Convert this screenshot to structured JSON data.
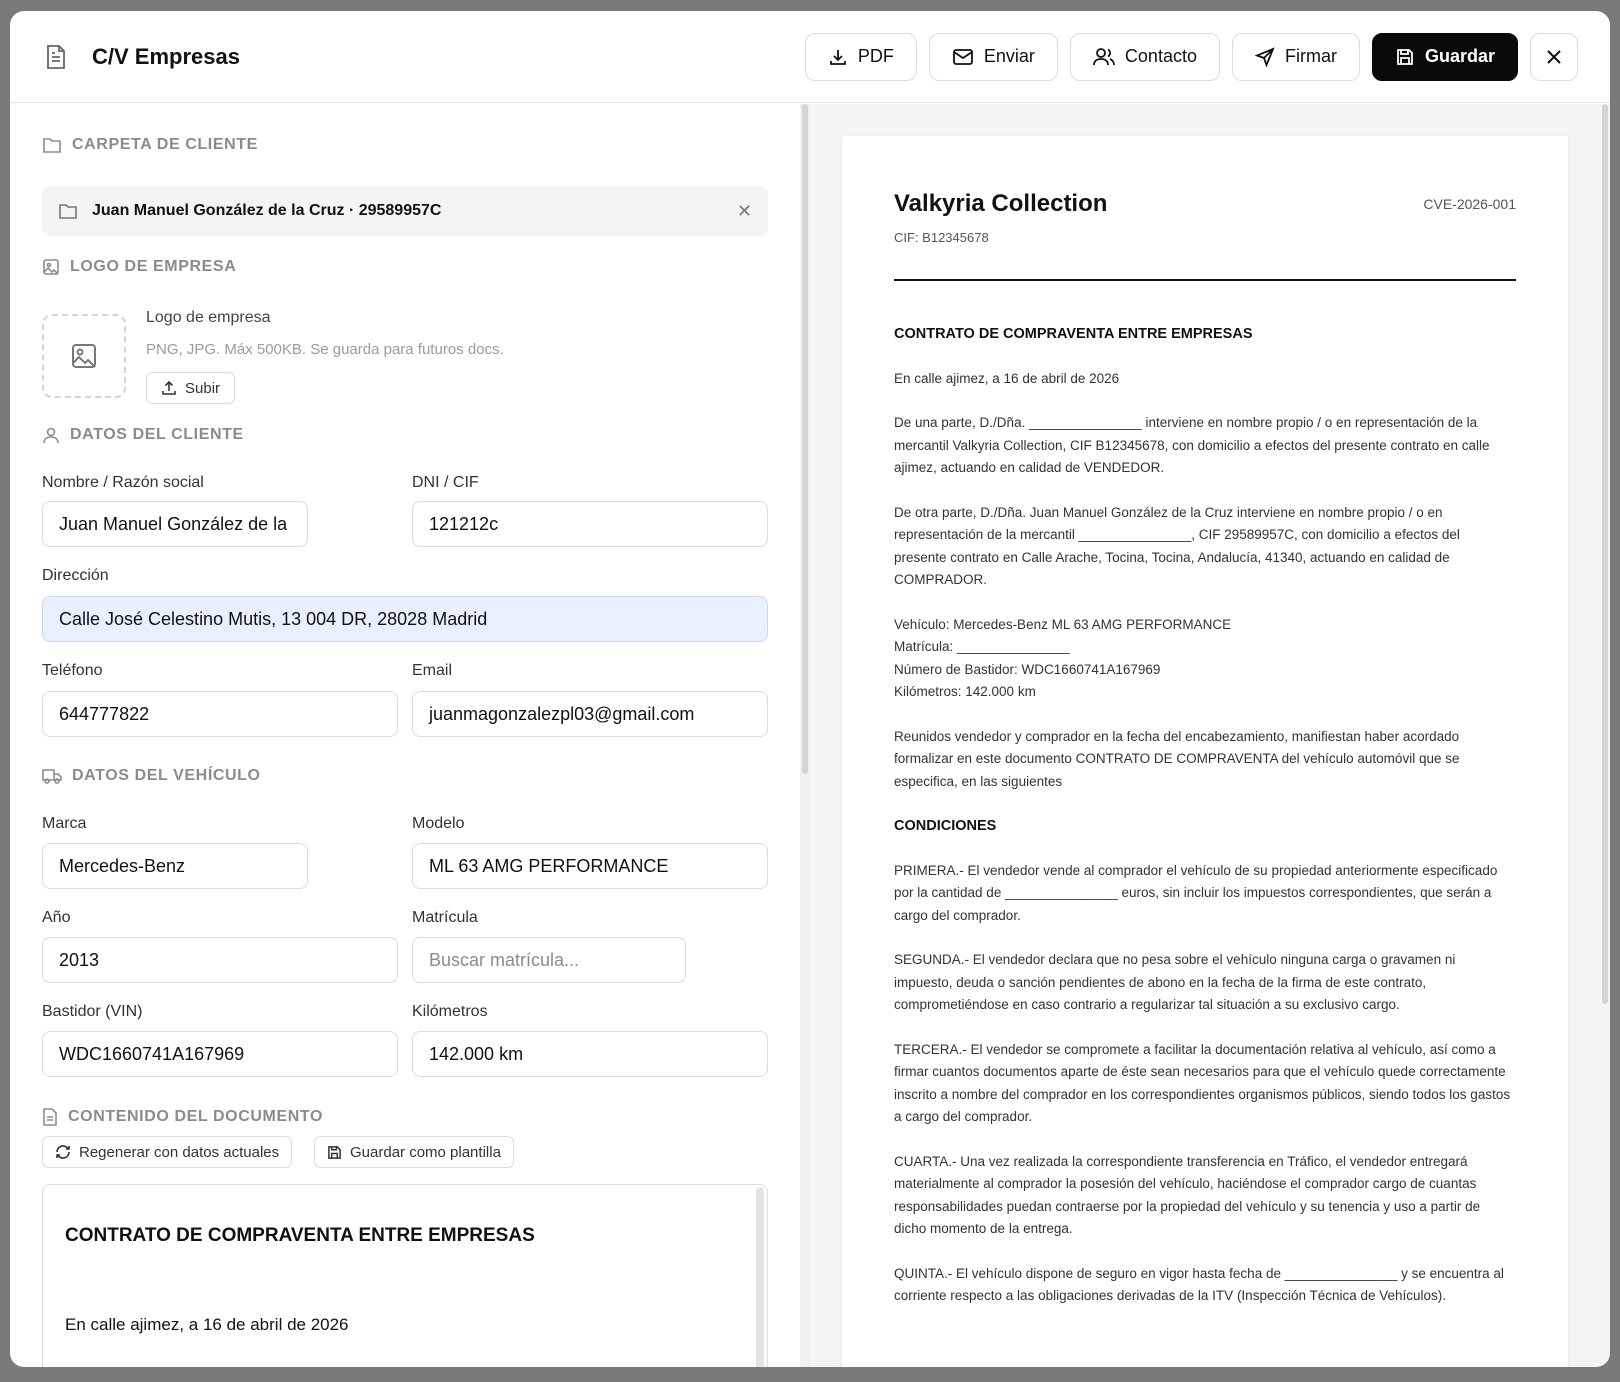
{
  "header": {
    "title": "C/V Empresas",
    "buttons": {
      "pdf": "PDF",
      "send": "Enviar",
      "contact": "Contacto",
      "sign": "Firmar",
      "save": "Guardar"
    }
  },
  "client_folder": {
    "section": "CARPETA DE CLIENTE",
    "value": "Juan Manuel González de la Cruz · 29589957C"
  },
  "logo": {
    "section": "LOGO DE EMPRESA",
    "title": "Logo de empresa",
    "hint": "PNG, JPG. Máx 500KB. Se guarda para futuros docs.",
    "upload": "Subir"
  },
  "client": {
    "section": "DATOS DEL CLIENTE",
    "name_label": "Nombre / Razón social",
    "name": "Juan Manuel González de la",
    "dni_label": "DNI / CIF",
    "dni": "121212c",
    "address_label": "Dirección",
    "address": "Calle José Celestino Mutis, 13 004 DR, 28028 Madrid",
    "phone_label": "Teléfono",
    "phone": "644777822",
    "email_label": "Email",
    "email": "juanmagonzalezpl03@gmail.com"
  },
  "vehicle": {
    "section": "DATOS DEL VEHÍCULO",
    "brand_label": "Marca",
    "brand": "Mercedes-Benz",
    "model_label": "Modelo",
    "model": "ML 63 AMG PERFORMANCE",
    "year_label": "Año",
    "year": "2013",
    "plate_label": "Matrícula",
    "plate_placeholder": "Buscar matrícula...",
    "vin_label": "Bastidor (VIN)",
    "vin": "WDC1660741A167969",
    "km_label": "Kilómetros",
    "km": "142.000 km"
  },
  "content": {
    "section": "CONTENIDO DEL DOCUMENTO",
    "regen": "Regenerar con datos actuales",
    "save_template": "Guardar como plantilla",
    "editor_title": "CONTRATO DE COMPRAVENTA ENTRE EMPRESAS",
    "editor_line": "En calle ajimez, a 16 de abril de 2026"
  },
  "preview": {
    "company": "Valkyria Collection",
    "ref": "CVE-2026-001",
    "cif": "CIF: B12345678",
    "heading": "CONTRATO DE COMPRAVENTA ENTRE EMPRESAS",
    "date_line": "En calle ajimez, a 16 de abril de 2026",
    "p1": "De una parte, D./Dña. _______________ interviene en nombre propio / o en representación de la mercantil Valkyria Collection, CIF B12345678, con domicilio a efectos del presente contrato en calle ajimez, actuando en calidad de VENDEDOR.",
    "p2": "De otra parte, D./Dña. Juan Manuel González de la Cruz interviene en nombre propio / o en representación de la mercantil _______________, CIF 29589957C, con domicilio a efectos del presente contrato en Calle Arache, Tocina, Tocina, Andalucía, 41340, actuando en calidad de COMPRADOR.",
    "vehicle_block": "Vehículo: Mercedes-Benz ML 63 AMG PERFORMANCE\nMatrícula: _______________\nNúmero de Bastidor: WDC1660741A167969\nKilómetros: 142.000 km",
    "p3": "Reunidos vendedor y comprador en la fecha del encabezamiento, manifiestan haber acordado formalizar en este documento CONTRATO DE COMPRAVENTA del vehículo automóvil que se especifica, en las siguientes",
    "conditions": "CONDICIONES",
    "c1": "PRIMERA.- El vendedor vende al comprador el vehículo de su propiedad anteriormente especificado por la cantidad de _______________ euros, sin incluir los impuestos correspondientes, que serán a cargo del comprador.",
    "c2": "SEGUNDA.- El vendedor declara que no pesa sobre el vehículo ninguna carga o gravamen ni impuesto, deuda o sanción pendientes de abono en la fecha de la firma de este contrato, comprometiéndose en caso contrario a regularizar tal situación a su exclusivo cargo.",
    "c3": "TERCERA.- El vendedor se compromete a facilitar la documentación relativa al vehículo, así como a firmar cuantos documentos aparte de éste sean necesarios para que el vehículo quede correctamente inscrito a nombre del comprador en los correspondientes organismos públicos, siendo todos los gastos a cargo del comprador.",
    "c4": "CUARTA.- Una vez realizada la correspondiente transferencia en Tráfico, el vendedor entregará materialmente al comprador la posesión del vehículo, haciéndose el comprador cargo de cuantas responsabilidades puedan contraerse por la propiedad del vehículo y su tenencia y uso a partir de dicho momento de la entrega.",
    "c5": "QUINTA.- El vehículo dispone de seguro en vigor hasta fecha de _______________ y se encuentra al corriente respecto a las obligaciones derivadas de la ITV (Inspección Técnica de Vehículos)."
  }
}
